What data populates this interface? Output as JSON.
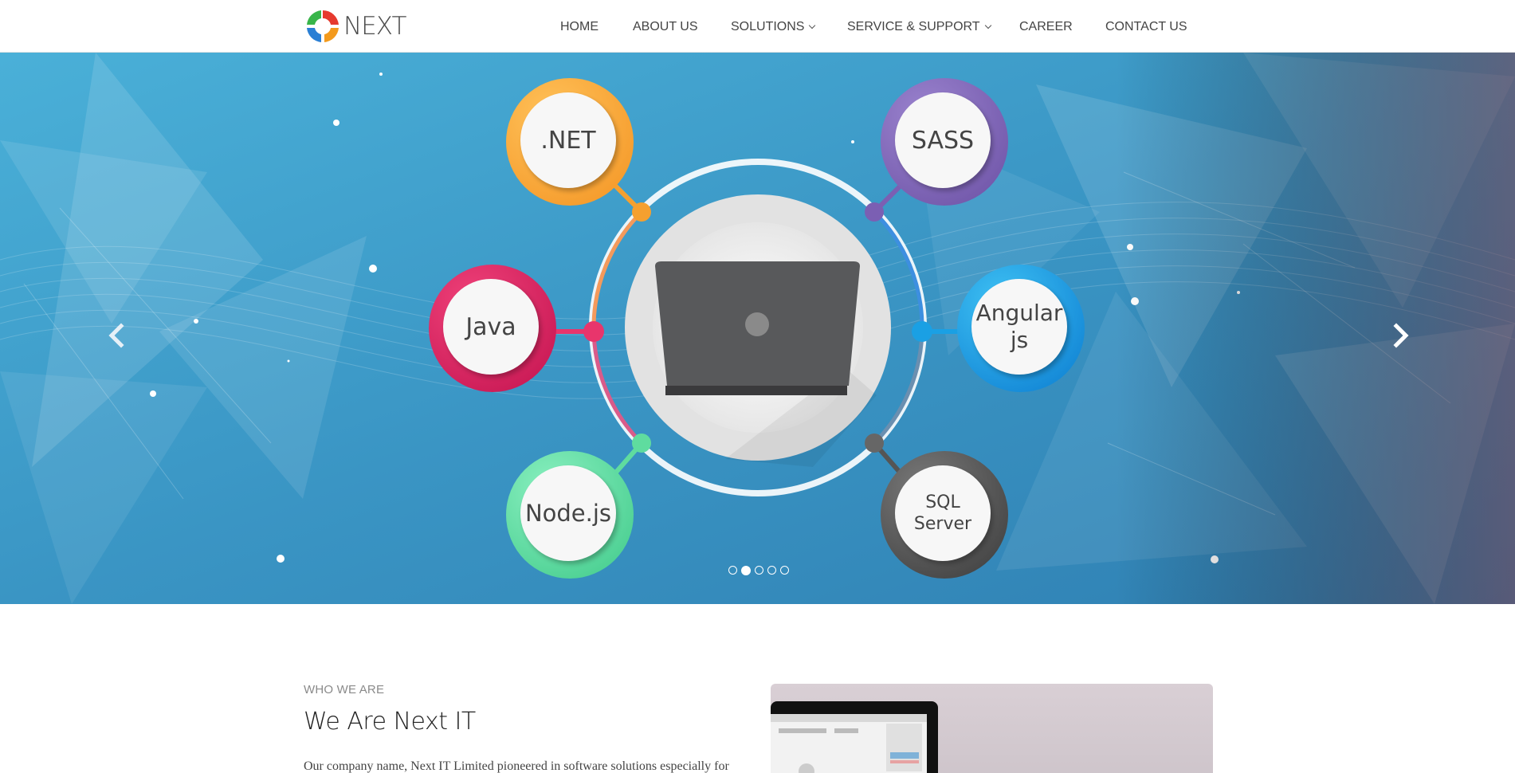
{
  "brand": {
    "name": "NEXT"
  },
  "nav": {
    "items": [
      {
        "label": "HOME",
        "has_dropdown": false
      },
      {
        "label": "ABOUT US",
        "has_dropdown": false
      },
      {
        "label": "SOLUTIONS",
        "has_dropdown": true
      },
      {
        "label": "SERVICE & SUPPORT",
        "has_dropdown": true
      },
      {
        "label": "CAREER",
        "has_dropdown": false
      },
      {
        "label": "CONTACT US",
        "has_dropdown": false
      }
    ]
  },
  "hero": {
    "technologies": [
      ".NET",
      "SASS",
      "Java",
      "Angular js",
      "Node.js",
      "SQL Server"
    ],
    "slides_count": 5,
    "active_slide": 2,
    "colors": {
      "net": "#f5a02f",
      "sass": "#7b5fb3",
      "java": "#d31a5a",
      "angular": "#1297e0",
      "node": "#4fd79a",
      "sql": "#555555",
      "background": "#3a94c2"
    }
  },
  "about": {
    "eyebrow": "WHO WE ARE",
    "heading": "We Are Next IT",
    "paragraph": "Our company name, Next IT Limited pioneered in software solutions especially for"
  }
}
